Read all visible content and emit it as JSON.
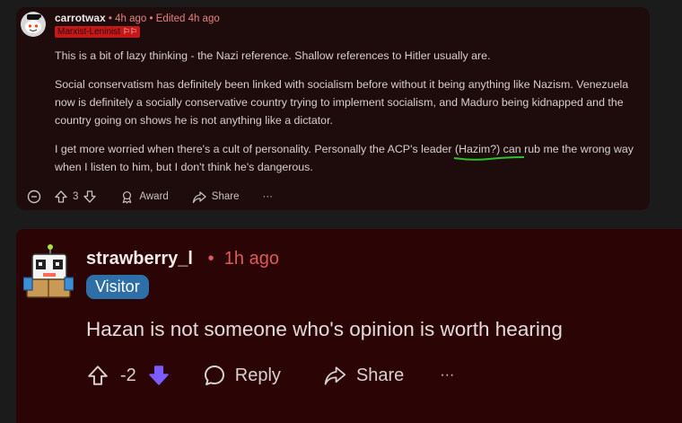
{
  "comment1": {
    "username": "carrotwax",
    "time": "4h ago",
    "edited": "Edited 4h ago",
    "flair": "Marxist-Leninist",
    "paragraphs": [
      "This is a bit of lazy thinking - the Nazi reference. Shallow references to Hitler usually are.",
      "Social conservatism has definitely been linked with socialism before without it being anything like Nazism. Venezuela now is definitely a socially conservative country trying to implement socialism, and Maduro being kidnapped and the country going on shows he is not anything like a dictator."
    ],
    "paragraph3_before": "I get more worried when there's a cult of personality. Personally the ACP's leader ",
    "paragraph3_highlight": "(Hazim?)",
    "paragraph3_after": " can rub me the wrong way when I listen to him, but I don't think he's dangerous.",
    "vote_count": "3",
    "award_label": "Award",
    "share_label": "Share",
    "more_label": "···",
    "colors": {
      "card_bg": "#1e0c0c",
      "meta_red": "#e58080",
      "flair_bg": "#c51818",
      "highlight_underline": "#2fbf2f"
    }
  },
  "comment2": {
    "username": "strawberry_l",
    "time": "1h ago",
    "flair": "Visitor",
    "body": "Hazan is not someone who's opinion is worth hearing",
    "vote_count": "-2",
    "reply_label": "Reply",
    "share_label": "Share",
    "more_label": "···",
    "colors": {
      "card_bg": "#2b0505",
      "flair_bg": "#2f6fa8",
      "downvote_active": "#7a5cff"
    }
  }
}
